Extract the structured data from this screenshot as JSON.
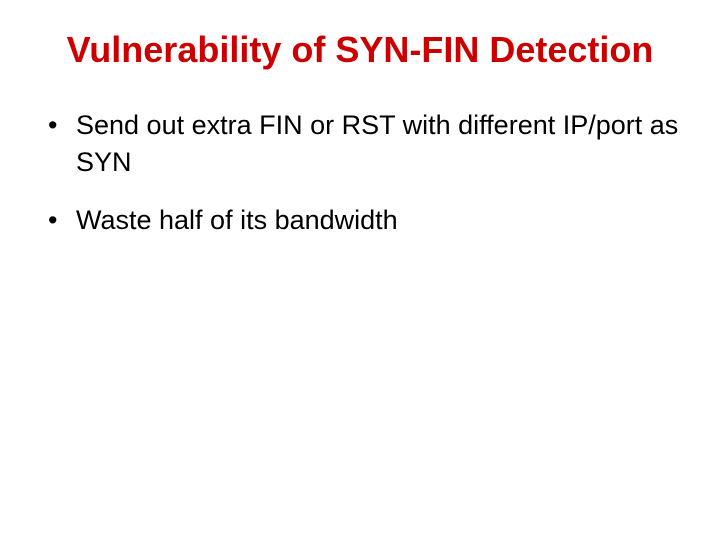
{
  "title": "Vulnerability of SYN-FIN Detection",
  "bullets": [
    "Send out extra FIN or RST with different IP/port as SYN",
    "Waste half of its bandwidth"
  ]
}
